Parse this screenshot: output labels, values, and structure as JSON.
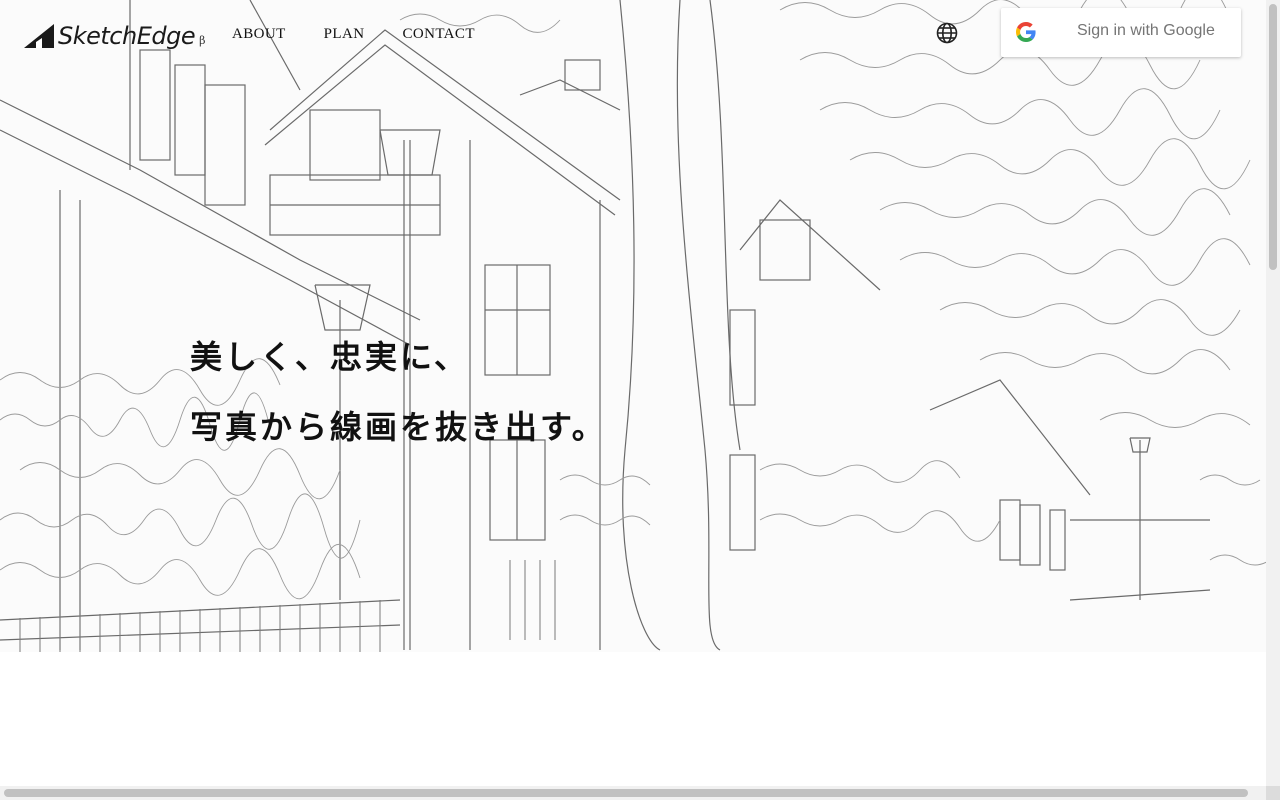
{
  "header": {
    "logo": {
      "name": "SketchEdge",
      "badge": "β"
    },
    "nav": [
      {
        "label": "ABOUT"
      },
      {
        "label": "PLAN"
      },
      {
        "label": "CONTACT"
      }
    ],
    "language_icon": "globe-icon",
    "sign_in": {
      "label": "Sign in with Google",
      "icon": "google-g-icon"
    }
  },
  "hero": {
    "headline_line1": "美しく、忠実に、",
    "headline_line2": "写真から線画を抜き出す。",
    "background": "line-drawing sketch of wooden houses, street lamps and trees"
  },
  "colors": {
    "text": "#111111",
    "button_text": "#757575",
    "background": "#ffffff"
  }
}
